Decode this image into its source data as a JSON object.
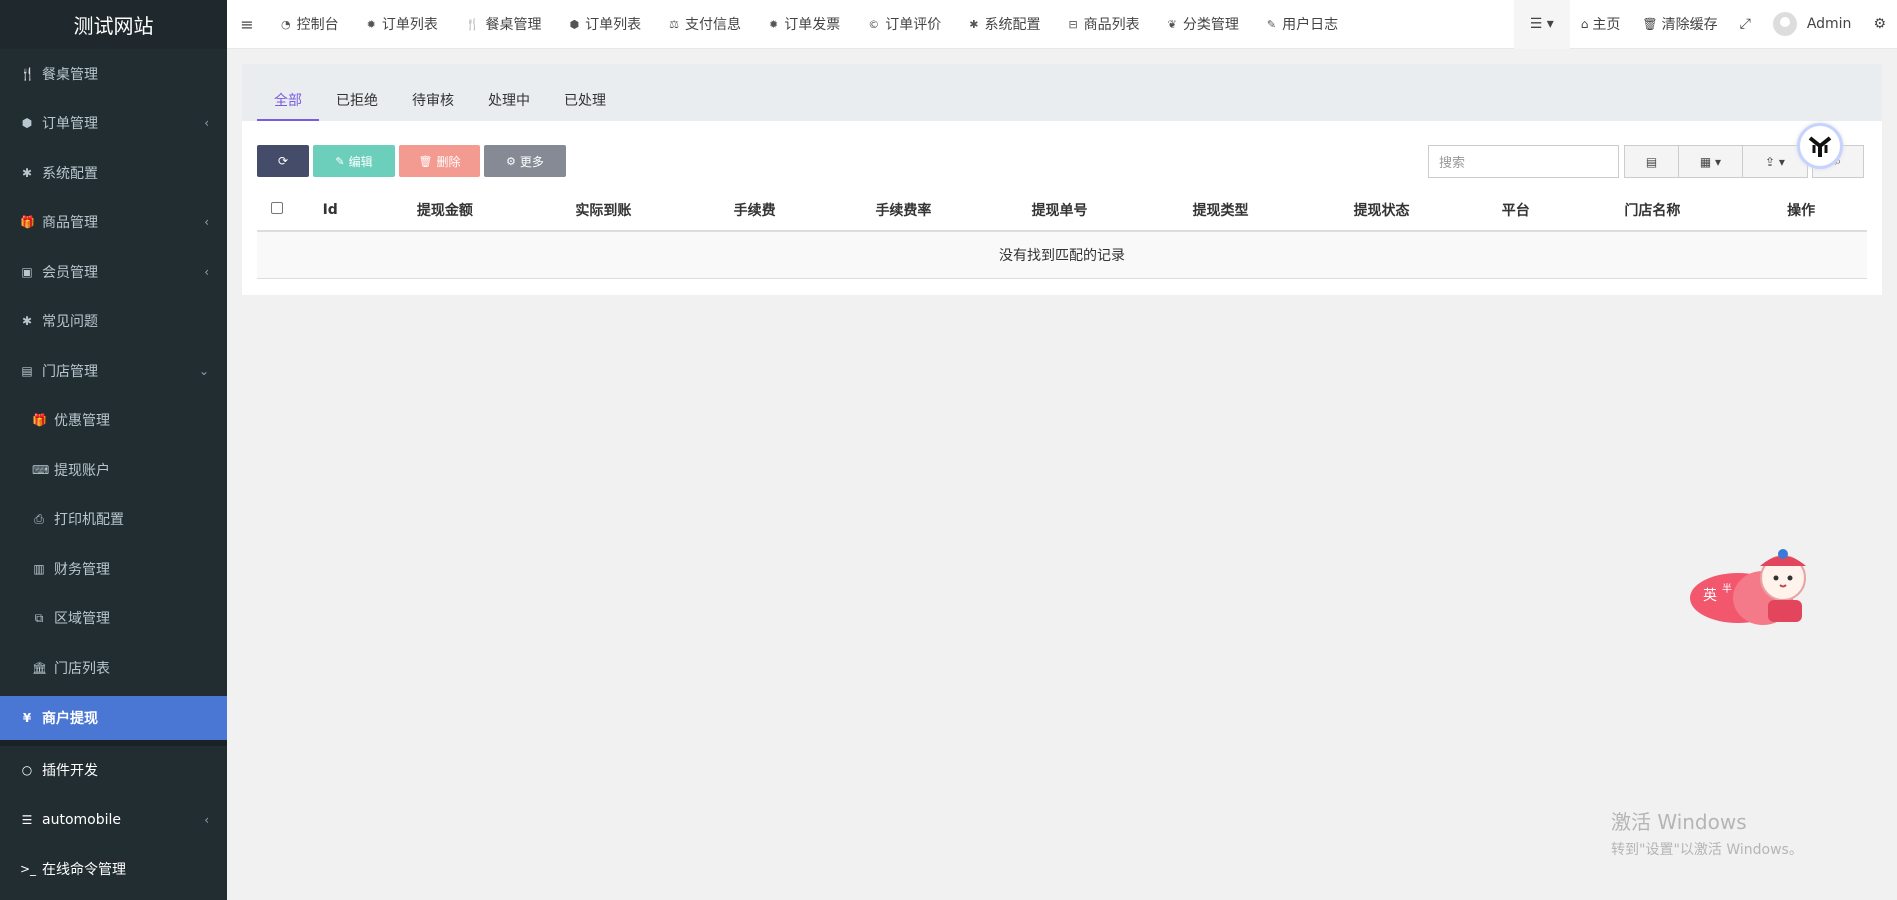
{
  "sidebar": {
    "logo": "测试网站",
    "items": [
      {
        "label": "餐桌管理",
        "icon": "utensils-icon",
        "glyph": "🍴",
        "caret": "",
        "sub": false
      },
      {
        "label": "订单管理",
        "icon": "cube-icon",
        "glyph": "⬢",
        "caret": "‹",
        "sub": false
      },
      {
        "label": "系统配置",
        "icon": "asterisk-icon",
        "glyph": "✱",
        "caret": "",
        "sub": false
      },
      {
        "label": "商品管理",
        "icon": "gift-icon",
        "glyph": "🎁",
        "caret": "‹",
        "sub": false
      },
      {
        "label": "会员管理",
        "icon": "address-book-icon",
        "glyph": "▣",
        "caret": "‹",
        "sub": false
      },
      {
        "label": "常见问题",
        "icon": "asterisk-icon",
        "glyph": "✱",
        "caret": "",
        "sub": false
      },
      {
        "label": "门店管理",
        "icon": "archive-icon",
        "glyph": "▤",
        "caret": "⌄",
        "sub": false
      },
      {
        "label": "优惠管理",
        "icon": "gift-icon",
        "glyph": "🎁",
        "caret": "",
        "sub": true
      },
      {
        "label": "提现账户",
        "icon": "keyboard-icon",
        "glyph": "⌨",
        "caret": "",
        "sub": true
      },
      {
        "label": "打印机配置",
        "icon": "print-icon",
        "glyph": "⎙",
        "caret": "",
        "sub": true
      },
      {
        "label": "财务管理",
        "icon": "money-icon",
        "glyph": "▥",
        "caret": "",
        "sub": true
      },
      {
        "label": "区域管理",
        "icon": "clone-icon",
        "glyph": "⧉",
        "caret": "",
        "sub": true
      },
      {
        "label": "门店列表",
        "icon": "bank-icon",
        "glyph": "🏛",
        "caret": "",
        "sub": true
      }
    ],
    "active": {
      "label": "商户提现",
      "icon": "yen-icon",
      "glyph": "¥"
    },
    "bottom": [
      {
        "label": "插件开发",
        "icon": "circle-icon",
        "glyph": "○",
        "caret": ""
      },
      {
        "label": "automobile",
        "icon": "list-icon",
        "glyph": "☰",
        "caret": "‹"
      },
      {
        "label": "在线命令管理",
        "icon": "terminal-icon",
        "glyph": ">_",
        "caret": ""
      }
    ]
  },
  "topnav": {
    "toggle": "≡",
    "links": [
      {
        "label": "控制台",
        "icon": "dashboard-icon",
        "glyph": "◔"
      },
      {
        "label": "订单列表",
        "icon": "gear-icon",
        "glyph": "✹"
      },
      {
        "label": "餐桌管理",
        "icon": "utensils-icon",
        "glyph": "🍴"
      },
      {
        "label": "订单列表",
        "icon": "cube-icon",
        "glyph": "⬢"
      },
      {
        "label": "支付信息",
        "icon": "balance-scale-icon",
        "glyph": "⚖"
      },
      {
        "label": "订单发票",
        "icon": "gear-icon",
        "glyph": "✹"
      },
      {
        "label": "订单评价",
        "icon": "copyright-icon",
        "glyph": "©"
      },
      {
        "label": "系统配置",
        "icon": "asterisk-icon",
        "glyph": "✱"
      },
      {
        "label": "商品列表",
        "icon": "basket-icon",
        "glyph": "⊟"
      },
      {
        "label": "分类管理",
        "icon": "leaf-icon",
        "glyph": "❦"
      },
      {
        "label": "用户日志",
        "icon": "pencil-icon",
        "glyph": "✎"
      }
    ],
    "right": {
      "menu_glyph": "☰ ▾",
      "home": "主页",
      "home_glyph": "⌂",
      "clear_cache": "清除缓存",
      "clear_glyph": "🗑",
      "fullscreen_glyph": "⤢",
      "user": "Admin",
      "settings_glyph": "⚙"
    }
  },
  "tabs": [
    "全部",
    "已拒绝",
    "待审核",
    "处理中",
    "已处理"
  ],
  "toolbar": {
    "refresh_glyph": "⟳",
    "edit": "编辑",
    "edit_glyph": "✎",
    "delete": "删除",
    "delete_glyph": "🗑",
    "more": "更多",
    "more_glyph": "⚙"
  },
  "search": {
    "placeholder": "搜索"
  },
  "table": {
    "columns": [
      "Id",
      "提现金额",
      "实际到账",
      "手续费",
      "手续费率",
      "提现单号",
      "提现类型",
      "提现状态",
      "平台",
      "门店名称",
      "操作"
    ],
    "empty": "没有找到匹配的记录"
  },
  "watermark": {
    "line1": "激活 Windows",
    "line2": "转到\"设置\"以激活 Windows。"
  },
  "colors": {
    "sidebar_bg": "#222d32",
    "active": "#4a77d4",
    "tab_active": "#7a5ce0"
  }
}
